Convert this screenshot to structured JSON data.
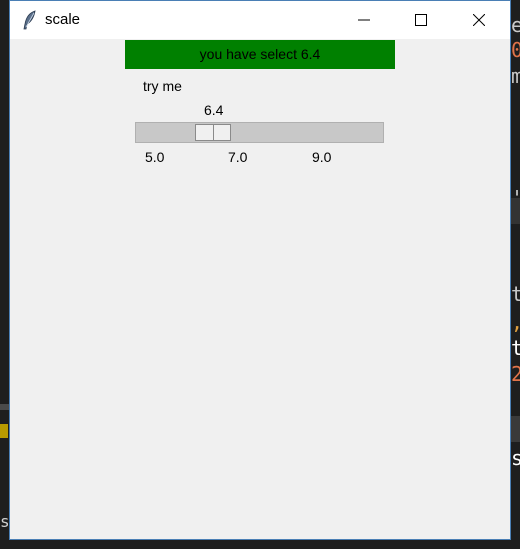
{
  "window": {
    "title": "scale",
    "app_icon": "feather-icon",
    "controls": {
      "minimize": "minimize-icon",
      "maximize": "maximize-icon",
      "close": "close-icon"
    }
  },
  "banner": {
    "text": "you have select 6.4",
    "color": "#008000"
  },
  "scale": {
    "label": "try me",
    "value_text": "6.4",
    "value": 6.4,
    "min": 5.0,
    "max": 10.0,
    "ticks": [
      "5.0",
      "7.0",
      "9.0"
    ]
  },
  "background_editor": {
    "chars": [
      {
        "text": "e",
        "color": "#c8c8c8"
      },
      {
        "text": "0",
        "color": "#e0734a"
      },
      {
        "text": "m",
        "color": "#c8c8c8"
      },
      {
        "text": "'",
        "color": "#c8c8c8"
      },
      {
        "text": "t",
        "color": "#c8c8c8"
      },
      {
        "text": ",",
        "color": "#e0a040"
      },
      {
        "text": "t",
        "color": "#ffffff"
      },
      {
        "text": "2",
        "color": "#e0734a"
      },
      {
        "text": "s",
        "color": "#ffffff"
      }
    ],
    "left_char": "s"
  }
}
